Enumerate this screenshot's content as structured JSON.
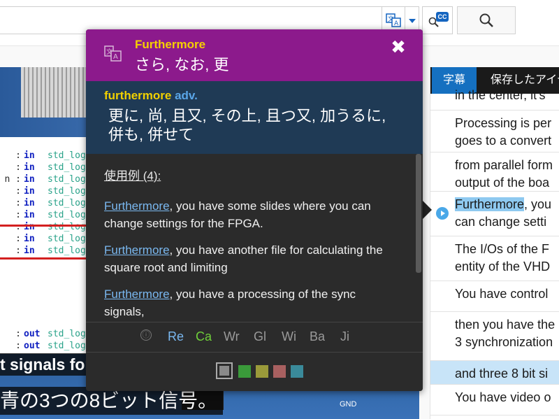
{
  "topbar": {
    "search_value": "",
    "translate_icon": "translate-icon",
    "cc_badge": "CC",
    "cc_search_icon": "cc-search-icon",
    "search_icon": "search-icon"
  },
  "video": {
    "code_lines": [
      {
        "prefix": ":",
        "kw": "in",
        "ty": "std_log"
      },
      {
        "prefix": ":",
        "kw": "in",
        "ty": "std_log"
      },
      {
        "prefix": "n :",
        "kw": "in",
        "ty": "std_log"
      },
      {
        "prefix": ":",
        "kw": "in",
        "ty": "std_log"
      },
      {
        "prefix": ":",
        "kw": "in",
        "ty": "std_log"
      },
      {
        "prefix": ":",
        "kw": "in",
        "ty": "std_log"
      },
      {
        "prefix": ":",
        "kw": "in",
        "ty": "std_log"
      },
      {
        "prefix": ":",
        "kw": "in",
        "ty": "std_log"
      },
      {
        "prefix": ":",
        "kw": "in",
        "ty": "std_log"
      },
      {
        "prefix": ":",
        "kw": "out",
        "ty": "std_log"
      },
      {
        "prefix": ":",
        "kw": "out",
        "ty": "std_log"
      }
    ],
    "gnd_label": "GND",
    "subtitle_en": "t signals for red, green, b",
    "subtitle_jp": "青の3つの8ビット信号。"
  },
  "panel": {
    "tabs": [
      "字幕",
      "保存したアイテム"
    ],
    "rows": [
      [
        "in the center, it's"
      ],
      [
        "Processing is per",
        "goes to a convert"
      ],
      [
        "from parallel form",
        "output of the boa"
      ],
      [
        "Furthermore, you",
        "can change setti"
      ],
      [
        "The I/Os of the F",
        "entity of the VHD"
      ],
      [
        "You have control"
      ],
      [
        "then you have the",
        "3 synchronization"
      ],
      [
        "and three 8 bit si"
      ],
      [
        "You have video o"
      ]
    ],
    "highlight_word": "Furthermore",
    "highlight_rest": ", you"
  },
  "popup": {
    "word": "Furthermore",
    "translation": "さら, なお, 更",
    "close_icon": "close-icon",
    "def_word": "furthermore",
    "def_pos": "adv.",
    "def_text": "更に, 尚, 且又, その上, 且つ又, 加うるに, 併も, 併せて",
    "examples_title": "使用例 (4):",
    "examples": [
      {
        "link": "Furthermore",
        "rest": ", you have some slides where you can change settings for the FPGA."
      },
      {
        "link": "Furthermore",
        "rest": ", you have another file for calculating the square root and limiting"
      },
      {
        "link": "Furthermore",
        "rest": ", you have a processing of the sync signals,"
      }
    ],
    "sources": [
      "Re",
      "Ca",
      "Wr",
      "Gl",
      "Wi",
      "Ba",
      "Ji"
    ],
    "info_icon": "ⓘ",
    "swatches": [
      "#8a8a8a",
      "#3a9a3a",
      "#9a9a3a",
      "#a86060",
      "#3a8a9a"
    ]
  }
}
